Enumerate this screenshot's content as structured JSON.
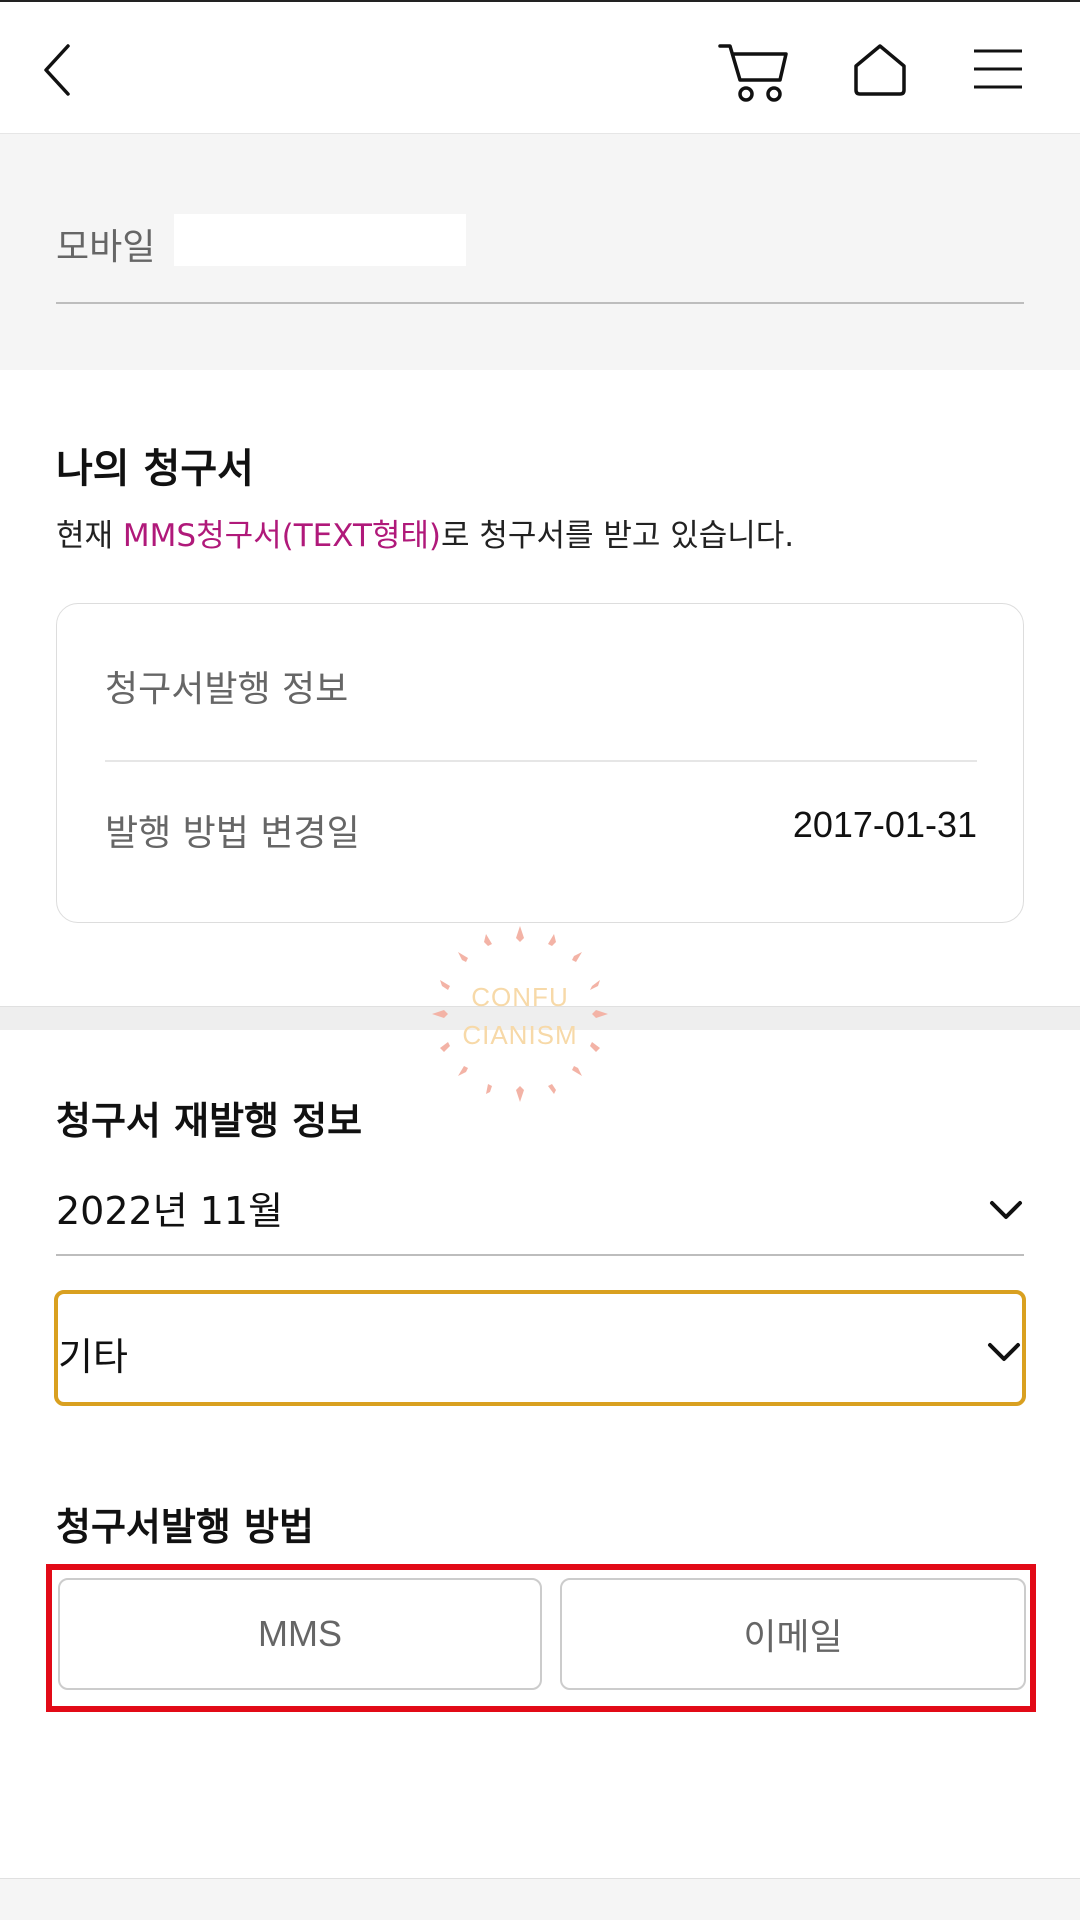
{
  "header": {
    "back_icon": "chevron-left-icon",
    "cart_icon": "cart-icon",
    "home_icon": "home-icon",
    "menu_icon": "hamburger-menu-icon"
  },
  "mobile": {
    "label": "모바일",
    "value": ""
  },
  "bill": {
    "title": "나의 청구서",
    "desc_prefix": "현재 ",
    "desc_highlight": "MMS청구서(TEXT형태)",
    "desc_suffix": "로 청구서를 받고 있습니다.",
    "highlight_color": "#b0197a",
    "card": {
      "title": "청구서발행 정보",
      "row_label": "발행 방법 변경일",
      "row_value": "2017-01-31"
    }
  },
  "watermark": {
    "line1": "CONFU",
    "line2": "CIANISM"
  },
  "reissue": {
    "title": "청구서 재발행 정보",
    "month_value": "2022년 11월",
    "reason_value": "기타",
    "focus_color": "#d9a020"
  },
  "method": {
    "title": "청구서발행 방법",
    "options": [
      "MMS",
      "이메일"
    ],
    "highlight_color": "#e20a17"
  }
}
